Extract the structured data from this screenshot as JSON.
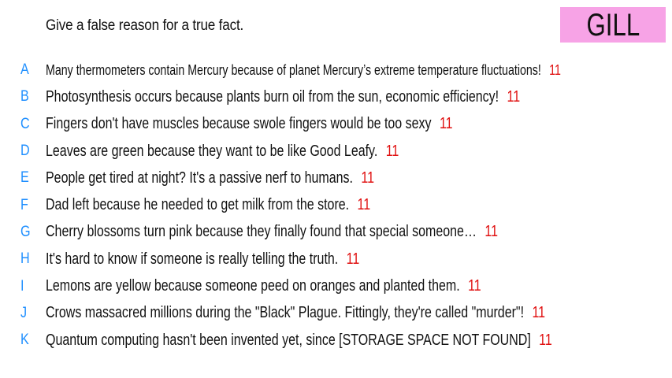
{
  "prompt": "Give a false reason for a true fact.",
  "player": "GILL",
  "colors": {
    "badge_bg": "#f7a3e6",
    "letter": "#1f8fff",
    "score": "#e01010",
    "text": "#111111"
  },
  "answers": [
    {
      "letter": "A",
      "text": "Many thermometers contain Mercury because of planet Mercury’s extreme temperature fluctuations!",
      "score": "11"
    },
    {
      "letter": "B",
      "text": "Photosynthesis occurs because plants burn oil from the sun, economic efficiency!",
      "score": "11"
    },
    {
      "letter": "C",
      "text": "Fingers don't have muscles because swole fingers would be too sexy",
      "score": "11"
    },
    {
      "letter": "D",
      "text": "Leaves are green because they want to be like Good Leafy.",
      "score": "11"
    },
    {
      "letter": "E",
      "text": "People get tired at night? It's a passive nerf to humans.",
      "score": "11"
    },
    {
      "letter": "F",
      "text": "Dad left because he needed to get milk from the store.",
      "score": "11"
    },
    {
      "letter": "G",
      "text": "Cherry blossoms turn pink because they finally found that special someone…",
      "score": "11"
    },
    {
      "letter": "H",
      "text": "It's hard to know if someone is really telling the truth.",
      "score": "11"
    },
    {
      "letter": "I",
      "text": "Lemons are yellow because someone peed on oranges and planted them.",
      "score": "11"
    },
    {
      "letter": "J",
      "text": "Crows massacred millions during the \"Black\" Plague. Fittingly, they're called \"murder\"!",
      "score": "11"
    },
    {
      "letter": "K",
      "text": "Quantum computing hasn't been invented yet, since [STORAGE SPACE NOT FOUND]",
      "score": "11"
    }
  ]
}
